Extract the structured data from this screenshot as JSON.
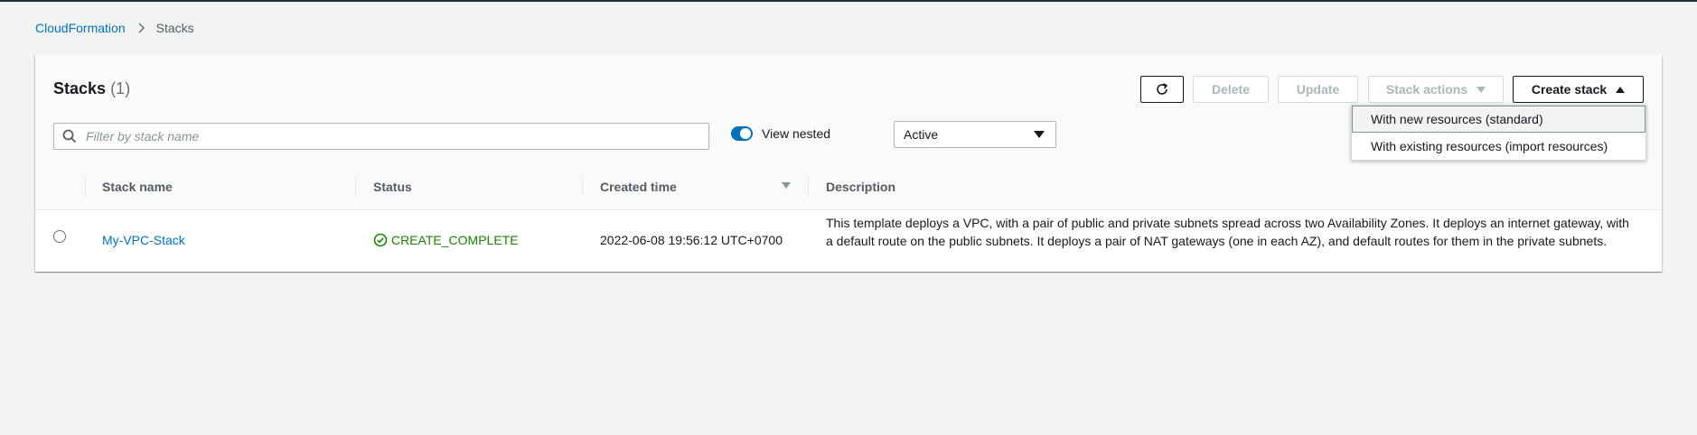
{
  "breadcrumb": {
    "root": "CloudFormation",
    "current": "Stacks"
  },
  "panel": {
    "title": "Stacks",
    "count": "(1)"
  },
  "toolbar": {
    "delete_label": "Delete",
    "update_label": "Update",
    "stack_actions_label": "Stack actions",
    "create_stack_label": "Create stack"
  },
  "create_menu": {
    "items": [
      {
        "label": "With new resources (standard)"
      },
      {
        "label": "With existing resources (import resources)"
      }
    ]
  },
  "search": {
    "placeholder": "Filter by stack name",
    "value": ""
  },
  "view_nested": {
    "label": "View nested",
    "enabled": true
  },
  "status_filter": {
    "selected": "Active"
  },
  "table": {
    "columns": [
      "Stack name",
      "Status",
      "Created time",
      "Description"
    ],
    "rows": [
      {
        "name": "My-VPC-Stack",
        "status": "CREATE_COMPLETE",
        "created": "2022-06-08 19:56:12 UTC+0700",
        "description": "This template deploys a VPC, with a pair of public and private subnets spread across two Availability Zones. It deploys an internet gateway, with a default route on the public subnets. It deploys a pair of NAT gateways (one in each AZ), and default routes for them in the private subnets."
      }
    ]
  },
  "colors": {
    "link": "#0073bb",
    "success": "#1d8102",
    "toggle": "#0073bb"
  },
  "icons": [
    "chevron-right-icon",
    "refresh-icon",
    "search-icon",
    "check-circle-icon",
    "caret-down-icon",
    "caret-up-icon",
    "sort-desc-icon"
  ]
}
